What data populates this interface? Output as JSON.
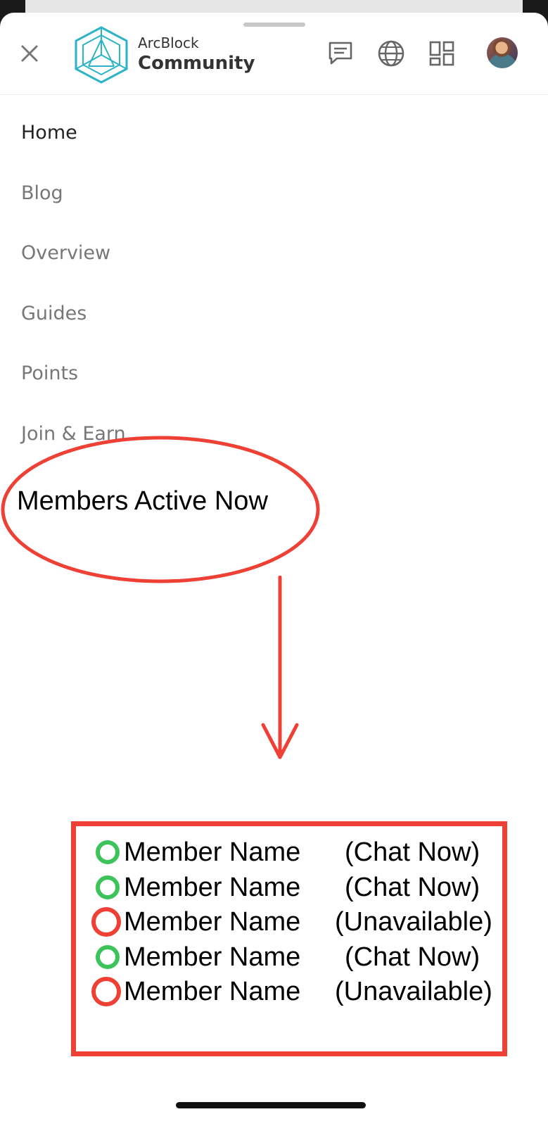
{
  "header": {
    "brand_top": "ArcBlock",
    "brand_bottom": "Community",
    "icons": [
      "close-icon",
      "chat-icon",
      "globe-icon",
      "apps-grid-icon",
      "avatar"
    ]
  },
  "nav": {
    "items": [
      {
        "label": "Home",
        "active": true
      },
      {
        "label": "Blog",
        "active": false
      },
      {
        "label": "Overview",
        "active": false
      },
      {
        "label": "Guides",
        "active": false
      },
      {
        "label": "Points",
        "active": false
      },
      {
        "label": "Join & Earn",
        "active": false
      }
    ]
  },
  "annotation": {
    "title": "Members Active Now"
  },
  "members": [
    {
      "name": "Member Name",
      "status": "online",
      "action": "(Chat Now)"
    },
    {
      "name": "Member Name",
      "status": "online",
      "action": "(Chat Now)"
    },
    {
      "name": "Member Name",
      "status": "offline",
      "action": "(Unavailable)"
    },
    {
      "name": "Member Name",
      "status": "online",
      "action": "(Chat Now)"
    },
    {
      "name": "Member Name",
      "status": "offline",
      "action": "(Unavailable)"
    }
  ],
  "colors": {
    "annotation_red": "#ef4036",
    "online_green": "#3cc45a",
    "logo_teal": "#2bb3c8"
  }
}
